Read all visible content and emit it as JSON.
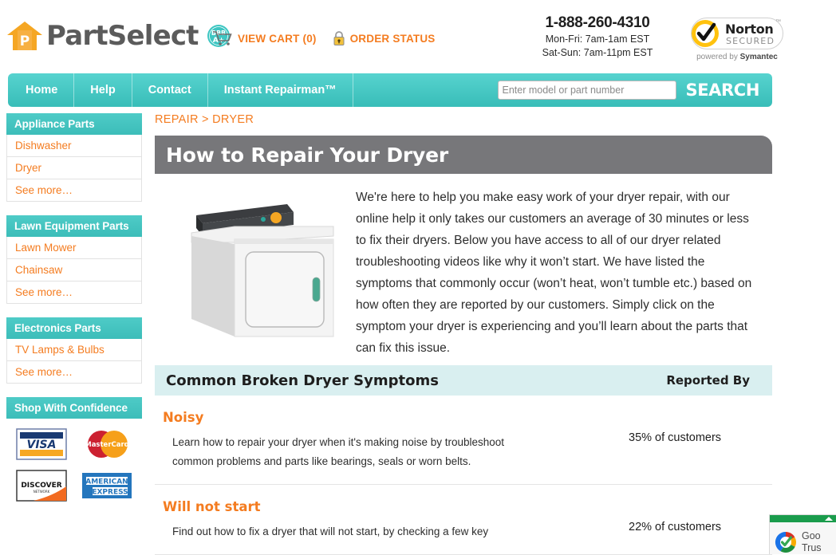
{
  "header": {
    "brand": "PartSelect",
    "bbb_badge": {
      "line1": "BBB",
      "line2": "A+"
    },
    "view_cart": "VIEW CART (0)",
    "order_status": "ORDER STATUS",
    "phone": "1-888-260-4310",
    "hours_weekday": "Mon-Fri: 7am-1am EST",
    "hours_weekend": "Sat-Sun: 7am-11pm EST",
    "norton": {
      "word": "Norton",
      "secured": "SECURED",
      "powered_prefix": "powered by ",
      "powered_brand": "Symantec"
    },
    "accent_orange": "#f47c20",
    "accent_teal": "#45c6c2"
  },
  "nav": {
    "items": [
      {
        "label": "Home"
      },
      {
        "label": "Help"
      },
      {
        "label": "Contact"
      },
      {
        "label": "Instant Repairman™"
      }
    ],
    "search_placeholder": "Enter model or part number",
    "search_value": "",
    "search_button": "SEARCH"
  },
  "sidebar": {
    "panels": [
      {
        "title": "Appliance Parts",
        "rows": [
          "Dishwasher",
          "Dryer",
          "See more…"
        ]
      },
      {
        "title": "Lawn Equipment Parts",
        "rows": [
          "Lawn Mower",
          "Chainsaw",
          "See more…"
        ]
      },
      {
        "title": "Electronics Parts",
        "rows": [
          "TV Lamps & Bulbs",
          "See more…"
        ]
      }
    ],
    "confidence_title": "Shop With Confidence",
    "payment_logos": [
      "VISA",
      "MasterCard",
      "DISCOVER NETWORK",
      "AMERICAN EXPRESS"
    ]
  },
  "main": {
    "breadcrumb": "REPAIR > DRYER",
    "page_title": "How to Repair Your Dryer",
    "intro": "We're here to help you make easy work of your dryer repair, with our online help it only takes our customers an average of 30 minutes or less to fix their dryers. Below you have access to all of our dryer related troubleshooting videos like why it won’t start. We have listed the symptoms that commonly occur (won’t heat, won’t tumble etc.) based on how often they are reported by our customers. Simply click on the symptom your dryer is experiencing and you’ll learn about the parts that can fix this issue.",
    "symptoms_header": "Common Broken Dryer Symptoms",
    "reported_by_header": "Reported By",
    "symptoms": [
      {
        "name": "Noisy",
        "desc": "Learn how to repair your dryer when it's making noise by troubleshoot common problems and parts like bearings, seals or worn belts.",
        "reported": "35% of customers"
      },
      {
        "name": "Will not start",
        "desc": "Find out how to fix a dryer that will not start, by checking a few key",
        "reported": "22% of customers"
      }
    ]
  },
  "google_badge": {
    "line1": "Goo",
    "line2": "Trus"
  }
}
